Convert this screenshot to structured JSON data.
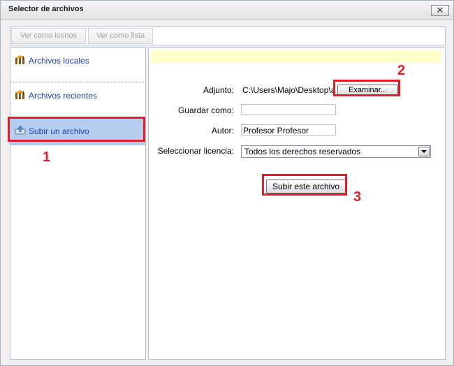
{
  "window": {
    "title": "Selector de archivos",
    "close_symbol": "✕"
  },
  "toolbar": {
    "icons_view": "Ver como iconos",
    "list_view": "Ver como lista"
  },
  "sidebar": {
    "items": [
      {
        "label": "Archivos locales",
        "icon": "repository-icon",
        "active": false
      },
      {
        "label": "Archivos recientes",
        "icon": "repository-icon",
        "active": false
      },
      {
        "label": "Subir un archivo",
        "icon": "upload-icon",
        "active": true
      }
    ]
  },
  "form": {
    "attachment_label": "Adjunto:",
    "attachment_value": "C:\\Users\\Majo\\Desktop\\a",
    "browse_label": "Examinar...",
    "save_as_label": "Guardar como:",
    "save_as_value": "",
    "author_label": "Autor:",
    "author_value": "Profesor Profesor",
    "license_label": "Seleccionar licencia:",
    "license_value": "Todos los derechos reservados",
    "submit_label": "Subir este archivo"
  },
  "annotations": {
    "marker_1": "1",
    "marker_2": "2",
    "marker_3": "3",
    "color": "#e21d2a"
  },
  "colors": {
    "link": "#1a3fb3",
    "active_bg": "#b5cdee",
    "notice_bg": "#ffffcc"
  }
}
